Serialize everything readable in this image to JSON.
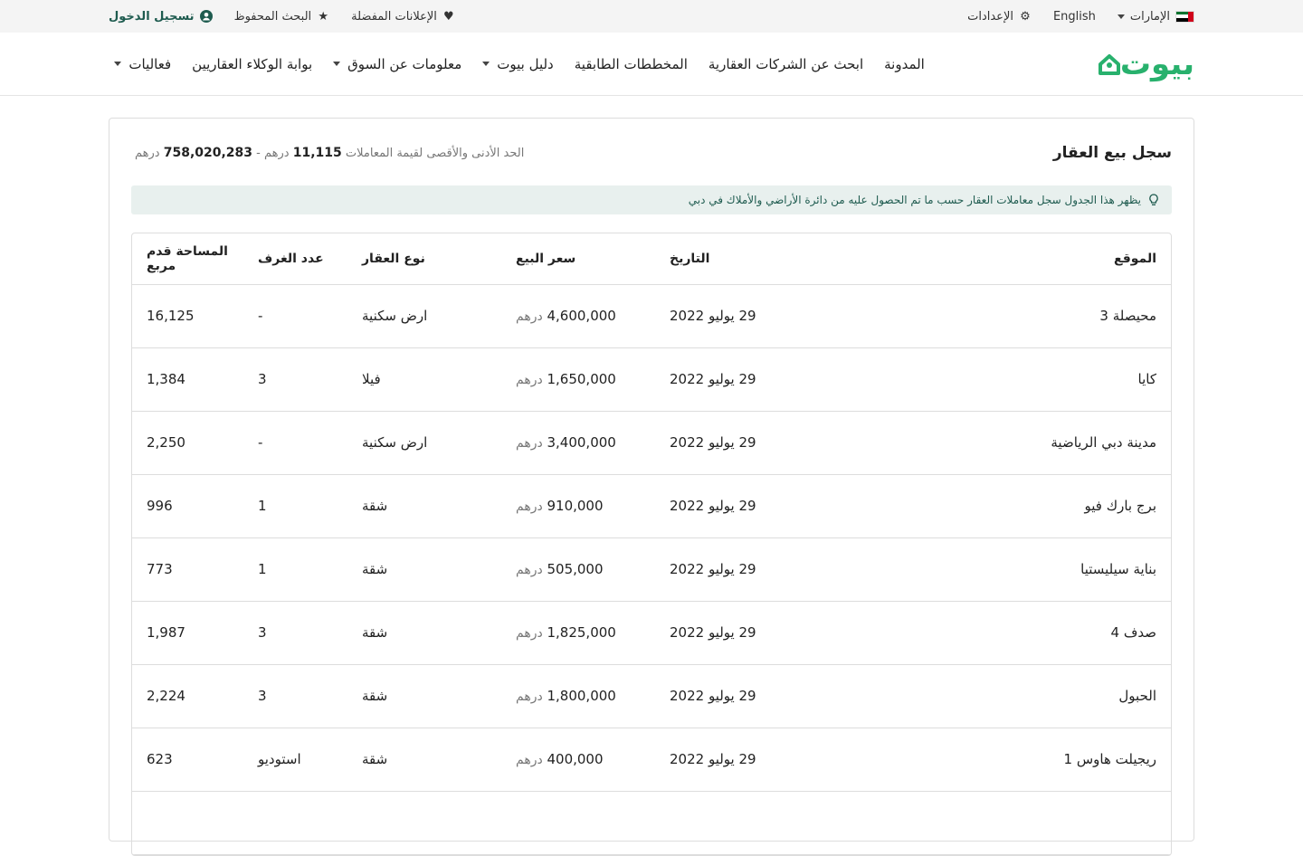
{
  "topbar": {
    "country": "الإمارات",
    "language": "English",
    "settings": "الإعدادات",
    "favorites": "الإعلانات المفضلة",
    "saved_search": "البحث المحفوظ",
    "login": "تسجيل الدخول",
    "flag_colors": [
      "#d0021b",
      "#00732f",
      "#ffffff",
      "#000000"
    ]
  },
  "nav": {
    "logo": "بيوت",
    "brand_color": "#28b16d",
    "links": [
      {
        "label": "المدونة",
        "dropdown": false
      },
      {
        "label": "ابحث عن الشركات العقارية",
        "dropdown": false
      },
      {
        "label": "المخططات الطابقية",
        "dropdown": false
      },
      {
        "label": "دليل بيوت",
        "dropdown": true
      },
      {
        "label": "معلومات عن السوق",
        "dropdown": true
      },
      {
        "label": "بوابة الوكلاء العقاريين",
        "dropdown": false
      },
      {
        "label": "فعاليات",
        "dropdown": true
      }
    ]
  },
  "card": {
    "title": "سجل بيع العقار",
    "range_label": "الحد الأدنى والأقصى لقيمة المعاملات",
    "range_min": "11,115",
    "range_max": "758,020,283",
    "currency": "درهم",
    "range_sep": "-",
    "notice": "يظهر هذا الجدول سجل معاملات العقار حسب ما تم الحصول عليه من دائرة الأراضي والأملاك في دبي"
  },
  "table": {
    "headers": {
      "location": "الموقع",
      "date": "التاريخ",
      "price": "سعر البيع",
      "type": "نوع العقار",
      "rooms": "عدد الغرف",
      "area": "المساحة قدم مربع"
    },
    "rows": [
      {
        "location": "محيصلة 3",
        "date": "29 يوليو 2022",
        "price": "4,600,000",
        "type": "ارض سكنية",
        "rooms": "-",
        "area": "16,125"
      },
      {
        "location": "كايا",
        "date": "29 يوليو 2022",
        "price": "1,650,000",
        "type": "فيلا",
        "rooms": "3",
        "area": "1,384"
      },
      {
        "location": "مدينة دبي الرياضية",
        "date": "29 يوليو 2022",
        "price": "3,400,000",
        "type": "ارض سكنية",
        "rooms": "-",
        "area": "2,250"
      },
      {
        "location": "برج بارك فيو",
        "date": "29 يوليو 2022",
        "price": "910,000",
        "type": "شقة",
        "rooms": "1",
        "area": "996"
      },
      {
        "location": "بناية سيليستيا",
        "date": "29 يوليو 2022",
        "price": "505,000",
        "type": "شقة",
        "rooms": "1",
        "area": "773"
      },
      {
        "location": "صدف 4",
        "date": "29 يوليو 2022",
        "price": "1,825,000",
        "type": "شقة",
        "rooms": "3",
        "area": "1,987"
      },
      {
        "location": "الحبول",
        "date": "29 يوليو 2022",
        "price": "1,800,000",
        "type": "شقة",
        "rooms": "3",
        "area": "2,224"
      },
      {
        "location": "ريجيلت هاوس 1",
        "date": "29 يوليو 2022",
        "price": "400,000",
        "type": "شقة",
        "rooms": "استوديو",
        "area": "623"
      }
    ]
  }
}
